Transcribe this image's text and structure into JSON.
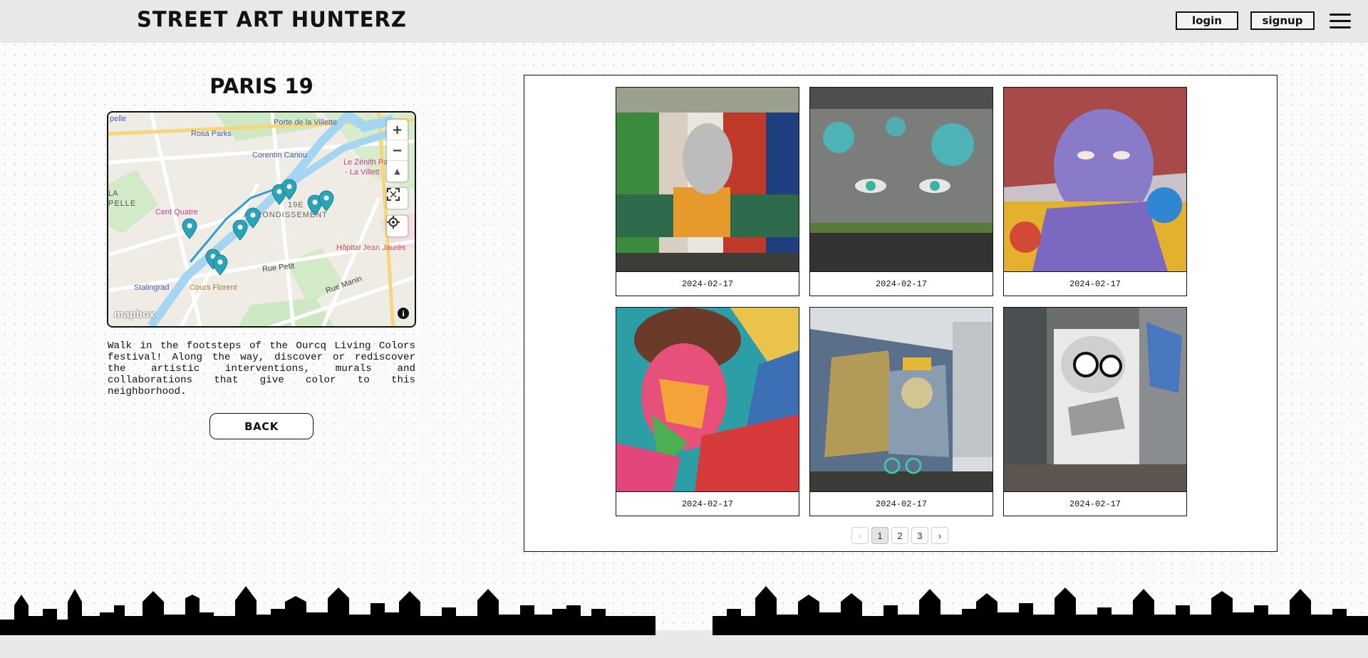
{
  "header": {
    "site_title": "STREET ART HUNTERZ",
    "login_label": "login",
    "signup_label": "signup",
    "menu_icon": "hamburger-menu-icon"
  },
  "route": {
    "title": "PARIS 19",
    "description": "Walk in the footsteps of the Ourcq Living Colors festival! Along the way, discover or rediscover the artistic interventions, murals and collaborations that give color to this neighborhood.",
    "back_label": "BACK"
  },
  "map": {
    "labels": {
      "porte_villette": "Porte de la Villette",
      "rosa_parks": "Rosa Parks",
      "corentin": "Corentin Cariou",
      "zenith": "Le Zénith Pa",
      "zenith2": "- La Villett",
      "cent_quatre": "Cent Quatre",
      "arrondissement": "19E",
      "arrondissement2": "ARRONDISSEMENT",
      "hopital": "Hôpital Jean Jaurès",
      "la": "LA",
      "pelle": "PELLE",
      "epelle": "pelle",
      "stalingrad": "Stalingrad",
      "cours_florent": "Cours Florent",
      "rue_petit": "Rue Petit",
      "rue_manin": "Rue Manin"
    },
    "controls": {
      "zoom_in": "+",
      "zoom_out": "−",
      "compass": "▲",
      "fullscreen": "fullscreen-icon",
      "geolocate": "geolocate-icon"
    },
    "attribution_logo": "mapbox",
    "marker_color": "#2aa4b8"
  },
  "gallery": {
    "items": [
      {
        "date": "2024-02-17"
      },
      {
        "date": "2024-02-17"
      },
      {
        "date": "2024-02-17"
      },
      {
        "date": "2024-02-17"
      },
      {
        "date": "2024-02-17"
      },
      {
        "date": "2024-02-17"
      }
    ],
    "pagination": {
      "prev": "‹",
      "pages": [
        "1",
        "2",
        "3"
      ],
      "current": "1",
      "next": "›"
    }
  }
}
